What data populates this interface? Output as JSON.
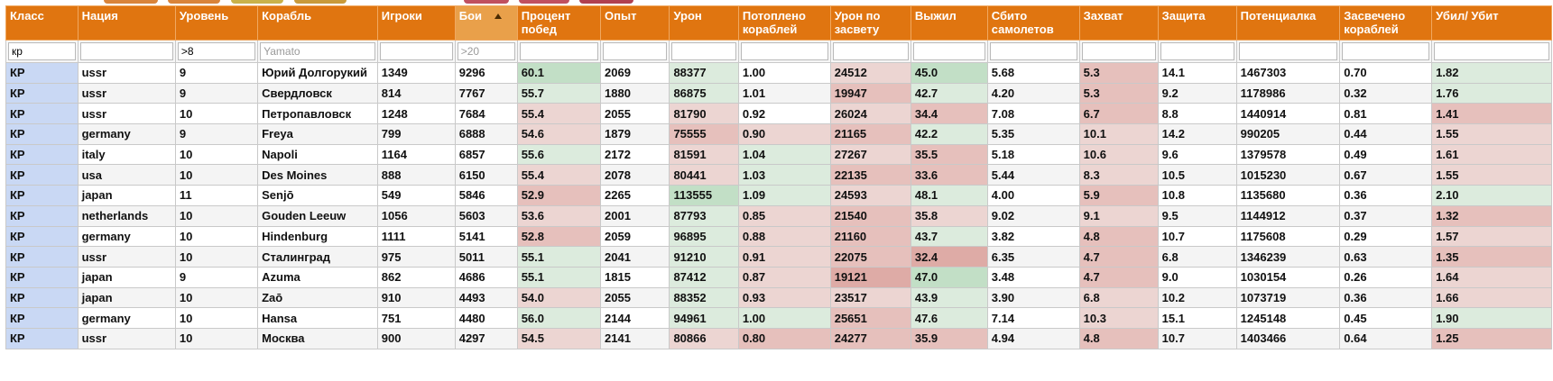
{
  "tab_stub_colors": [
    "#d9843a",
    "#d9843a",
    "#c9b24a",
    "#c99a3a",
    "#c05060",
    "#c05060",
    "#b04050"
  ],
  "columns": [
    {
      "key": "cls",
      "label": "Класс",
      "width": 75
    },
    {
      "key": "nation",
      "label": "Нация",
      "width": 102
    },
    {
      "key": "tier",
      "label": "Уровень",
      "width": 86
    },
    {
      "key": "ship",
      "label": "Корабль",
      "width": 125
    },
    {
      "key": "players",
      "label": "Игроки",
      "width": 81
    },
    {
      "key": "battles",
      "label": "Бои",
      "width": 65
    },
    {
      "key": "winrate",
      "label": "Процент побед",
      "width": 87
    },
    {
      "key": "xp",
      "label": "Опыт",
      "width": 72
    },
    {
      "key": "damage",
      "label": "Урон",
      "width": 72
    },
    {
      "key": "sunk",
      "label": "Потоплено кораблей",
      "width": 96
    },
    {
      "key": "spot_dmg",
      "label": "Урон по засвету",
      "width": 84
    },
    {
      "key": "survived",
      "label": "Выжил",
      "width": 80
    },
    {
      "key": "planes",
      "label": "Сбито самолетов",
      "width": 96
    },
    {
      "key": "capture",
      "label": "Захват",
      "width": 82
    },
    {
      "key": "defense",
      "label": "Защита",
      "width": 82
    },
    {
      "key": "potential",
      "label": "Потенциалка",
      "width": 108
    },
    {
      "key": "spotted",
      "label": "Засвечено кораблей",
      "width": 96
    },
    {
      "key": "kd",
      "label": "Убил/ Убит",
      "width": 125
    }
  ],
  "sorted_column": "battles",
  "sort_direction": "descending",
  "filters": {
    "cls": {
      "value": "кр",
      "placeholder": ""
    },
    "tier": {
      "value": ">8",
      "placeholder": ""
    },
    "ship": {
      "value": "",
      "placeholder": "Yamato"
    },
    "battles": {
      "value": "",
      "placeholder": ">20"
    }
  },
  "heat_colors": {
    "class_cell": "#c9d8f4",
    "good_strong": "#c2dfc6",
    "good_light": "#dcebdd",
    "bad_light": "#ecd5d2",
    "bad_mid": "#e6c0bc",
    "bad_strong": "#deaba6"
  },
  "rows": [
    [
      "КР",
      "ussr",
      "9",
      "Юрий Долгорукий",
      "1349",
      "9296",
      "60.1",
      "2069",
      "88377",
      "1.00",
      "24512",
      "45.0",
      "5.68",
      "5.3",
      "14.1",
      "1467303",
      "0.70",
      "1.82"
    ],
    [
      "КР",
      "ussr",
      "9",
      "Свердловск",
      "814",
      "7767",
      "55.7",
      "1880",
      "86875",
      "1.01",
      "19947",
      "42.7",
      "4.20",
      "5.3",
      "9.2",
      "1178986",
      "0.32",
      "1.76"
    ],
    [
      "КР",
      "ussr",
      "10",
      "Петропавловск",
      "1248",
      "7684",
      "55.4",
      "2055",
      "81790",
      "0.92",
      "26024",
      "34.4",
      "7.08",
      "6.7",
      "8.8",
      "1440914",
      "0.81",
      "1.41"
    ],
    [
      "КР",
      "germany",
      "9",
      "Freya",
      "799",
      "6888",
      "54.6",
      "1879",
      "75555",
      "0.90",
      "21165",
      "42.2",
      "5.35",
      "10.1",
      "14.2",
      "990205",
      "0.44",
      "1.55"
    ],
    [
      "КР",
      "italy",
      "10",
      "Napoli",
      "1164",
      "6857",
      "55.6",
      "2172",
      "81591",
      "1.04",
      "27267",
      "35.5",
      "5.18",
      "10.6",
      "9.6",
      "1379578",
      "0.49",
      "1.61"
    ],
    [
      "КР",
      "usa",
      "10",
      "Des Moines",
      "888",
      "6150",
      "55.4",
      "2078",
      "80441",
      "1.03",
      "22135",
      "33.6",
      "5.44",
      "8.3",
      "10.5",
      "1015230",
      "0.67",
      "1.55"
    ],
    [
      "КР",
      "japan",
      "11",
      "Senjō",
      "549",
      "5846",
      "52.9",
      "2265",
      "113555",
      "1.09",
      "24593",
      "48.1",
      "4.00",
      "5.9",
      "10.8",
      "1135680",
      "0.36",
      "2.10"
    ],
    [
      "КР",
      "netherlands",
      "10",
      "Gouden Leeuw",
      "1056",
      "5603",
      "53.6",
      "2001",
      "87793",
      "0.85",
      "21540",
      "35.8",
      "9.02",
      "9.1",
      "9.5",
      "1144912",
      "0.37",
      "1.32"
    ],
    [
      "КР",
      "germany",
      "10",
      "Hindenburg",
      "1111",
      "5141",
      "52.8",
      "2059",
      "96895",
      "0.88",
      "21160",
      "43.7",
      "3.82",
      "4.8",
      "10.7",
      "1175608",
      "0.29",
      "1.57"
    ],
    [
      "КР",
      "ussr",
      "10",
      "Сталинград",
      "975",
      "5011",
      "55.1",
      "2041",
      "91210",
      "0.91",
      "22075",
      "32.4",
      "6.35",
      "4.7",
      "6.8",
      "1346239",
      "0.63",
      "1.35"
    ],
    [
      "КР",
      "japan",
      "9",
      "Azuma",
      "862",
      "4686",
      "55.1",
      "1815",
      "87412",
      "0.87",
      "19121",
      "47.0",
      "3.48",
      "4.7",
      "9.0",
      "1030154",
      "0.26",
      "1.64"
    ],
    [
      "КР",
      "japan",
      "10",
      "Zaō",
      "910",
      "4493",
      "54.0",
      "2055",
      "88352",
      "0.93",
      "23517",
      "43.9",
      "3.90",
      "6.8",
      "10.2",
      "1073719",
      "0.36",
      "1.66"
    ],
    [
      "КР",
      "germany",
      "10",
      "Hansa",
      "751",
      "4480",
      "56.0",
      "2144",
      "94961",
      "1.00",
      "25651",
      "47.6",
      "7.14",
      "10.3",
      "15.1",
      "1245148",
      "0.45",
      "1.90"
    ],
    [
      "КР",
      "ussr",
      "10",
      "Москва",
      "900",
      "4297",
      "54.5",
      "2141",
      "80866",
      "0.80",
      "24277",
      "35.9",
      "4.94",
      "4.8",
      "10.7",
      "1403466",
      "0.64",
      "1.25"
    ]
  ],
  "row_heat": [
    {
      "winrate": "good_strong",
      "damage": "good_light",
      "spot_dmg": "bad_light",
      "survived": "good_strong",
      "capture": "bad_mid",
      "kd": "good_light"
    },
    {
      "winrate": "good_light",
      "damage": "good_light",
      "spot_dmg": "bad_mid",
      "survived": "good_light",
      "capture": "bad_mid",
      "kd": "good_light"
    },
    {
      "winrate": "bad_light",
      "damage": "bad_light",
      "spot_dmg": "bad_light",
      "survived": "bad_mid",
      "capture": "bad_mid",
      "kd": "bad_mid"
    },
    {
      "winrate": "bad_light",
      "damage": "bad_mid",
      "sunk": "bad_light",
      "spot_dmg": "bad_mid",
      "survived": "good_light",
      "capture": "bad_light",
      "kd": "bad_light"
    },
    {
      "winrate": "good_light",
      "damage": "bad_light",
      "sunk": "good_light",
      "spot_dmg": "bad_light",
      "survived": "bad_mid",
      "capture": "bad_light",
      "kd": "bad_light"
    },
    {
      "winrate": "bad_light",
      "damage": "bad_light",
      "sunk": "good_light",
      "spot_dmg": "bad_mid",
      "survived": "bad_mid",
      "capture": "bad_light",
      "kd": "bad_light"
    },
    {
      "winrate": "bad_mid",
      "damage": "good_strong",
      "sunk": "good_light",
      "spot_dmg": "bad_light",
      "survived": "good_light",
      "capture": "bad_mid",
      "kd": "good_light"
    },
    {
      "winrate": "bad_light",
      "damage": "good_light",
      "sunk": "bad_light",
      "spot_dmg": "bad_mid",
      "survived": "bad_light",
      "capture": "bad_light",
      "kd": "bad_mid"
    },
    {
      "winrate": "bad_mid",
      "damage": "good_light",
      "sunk": "bad_light",
      "spot_dmg": "bad_mid",
      "survived": "good_light",
      "capture": "bad_mid",
      "kd": "bad_light"
    },
    {
      "winrate": "good_light",
      "damage": "good_light",
      "sunk": "bad_light",
      "spot_dmg": "bad_mid",
      "survived": "bad_strong",
      "capture": "bad_mid",
      "kd": "bad_mid"
    },
    {
      "winrate": "good_light",
      "damage": "good_light",
      "sunk": "bad_light",
      "spot_dmg": "bad_strong",
      "survived": "good_strong",
      "capture": "bad_mid",
      "kd": "bad_light"
    },
    {
      "winrate": "bad_light",
      "damage": "good_light",
      "sunk": "bad_light",
      "spot_dmg": "bad_light",
      "survived": "good_light",
      "capture": "bad_light",
      "kd": "bad_light"
    },
    {
      "winrate": "good_light",
      "damage": "good_light",
      "sunk": "good_light",
      "spot_dmg": "bad_mid",
      "survived": "good_light",
      "capture": "bad_light",
      "kd": "good_light"
    },
    {
      "winrate": "bad_light",
      "damage": "bad_light",
      "sunk": "bad_mid",
      "spot_dmg": "bad_mid",
      "survived": "bad_mid",
      "capture": "bad_mid",
      "kd": "bad_mid"
    }
  ]
}
